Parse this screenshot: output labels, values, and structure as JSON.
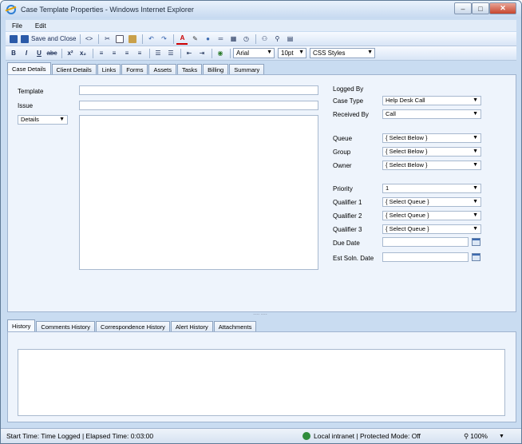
{
  "window": {
    "title": "Case Template Properties - Windows Internet Explorer"
  },
  "menu": [
    "File",
    "Edit"
  ],
  "toolbar": {
    "save_close": "Save and Close",
    "source": "<>",
    "font": "Arial",
    "size": "10pt",
    "styles": "CSS Styles",
    "bold": "B",
    "italic": "I",
    "underline": "U",
    "strike": "abc",
    "superscript": "x²",
    "subscript": "x₂"
  },
  "top_tabs": [
    "Case Details",
    "Client Details",
    "Links",
    "Forms",
    "Assets",
    "Tasks",
    "Billing",
    "Summary"
  ],
  "case_details": {
    "template_label": "Template",
    "issue_label": "Issue",
    "details_select": "Details",
    "logged_by_label": "Logged By",
    "case_type_label": "Case Type",
    "case_type_value": "Help Desk Call",
    "received_by_label": "Received By",
    "received_by_value": "Call",
    "queue_label": "Queue",
    "queue_value": "{ Select Below }",
    "group_label": "Group",
    "group_value": "{ Select Below }",
    "owner_label": "Owner",
    "owner_value": "{ Select Below }",
    "priority_label": "Priority",
    "priority_value": "1",
    "qualifier1_label": "Qualifier 1",
    "qualifier1_value": "{ Select Queue }",
    "qualifier2_label": "Qualifier 2",
    "qualifier2_value": "{ Select Queue }",
    "qualifier3_label": "Qualifier 3",
    "qualifier3_value": "{ Select Queue }",
    "due_date_label": "Due Date",
    "est_soln_label": "Est Soln. Date"
  },
  "bottom_tabs": [
    "History",
    "Comments History",
    "Correspondence History",
    "Alert History",
    "Attachments"
  ],
  "status": {
    "left": "Start Time: Time Logged | Elapsed Time: 0:03:00",
    "zone": "Local intranet | Protected Mode: Off",
    "zoom": "100%"
  }
}
